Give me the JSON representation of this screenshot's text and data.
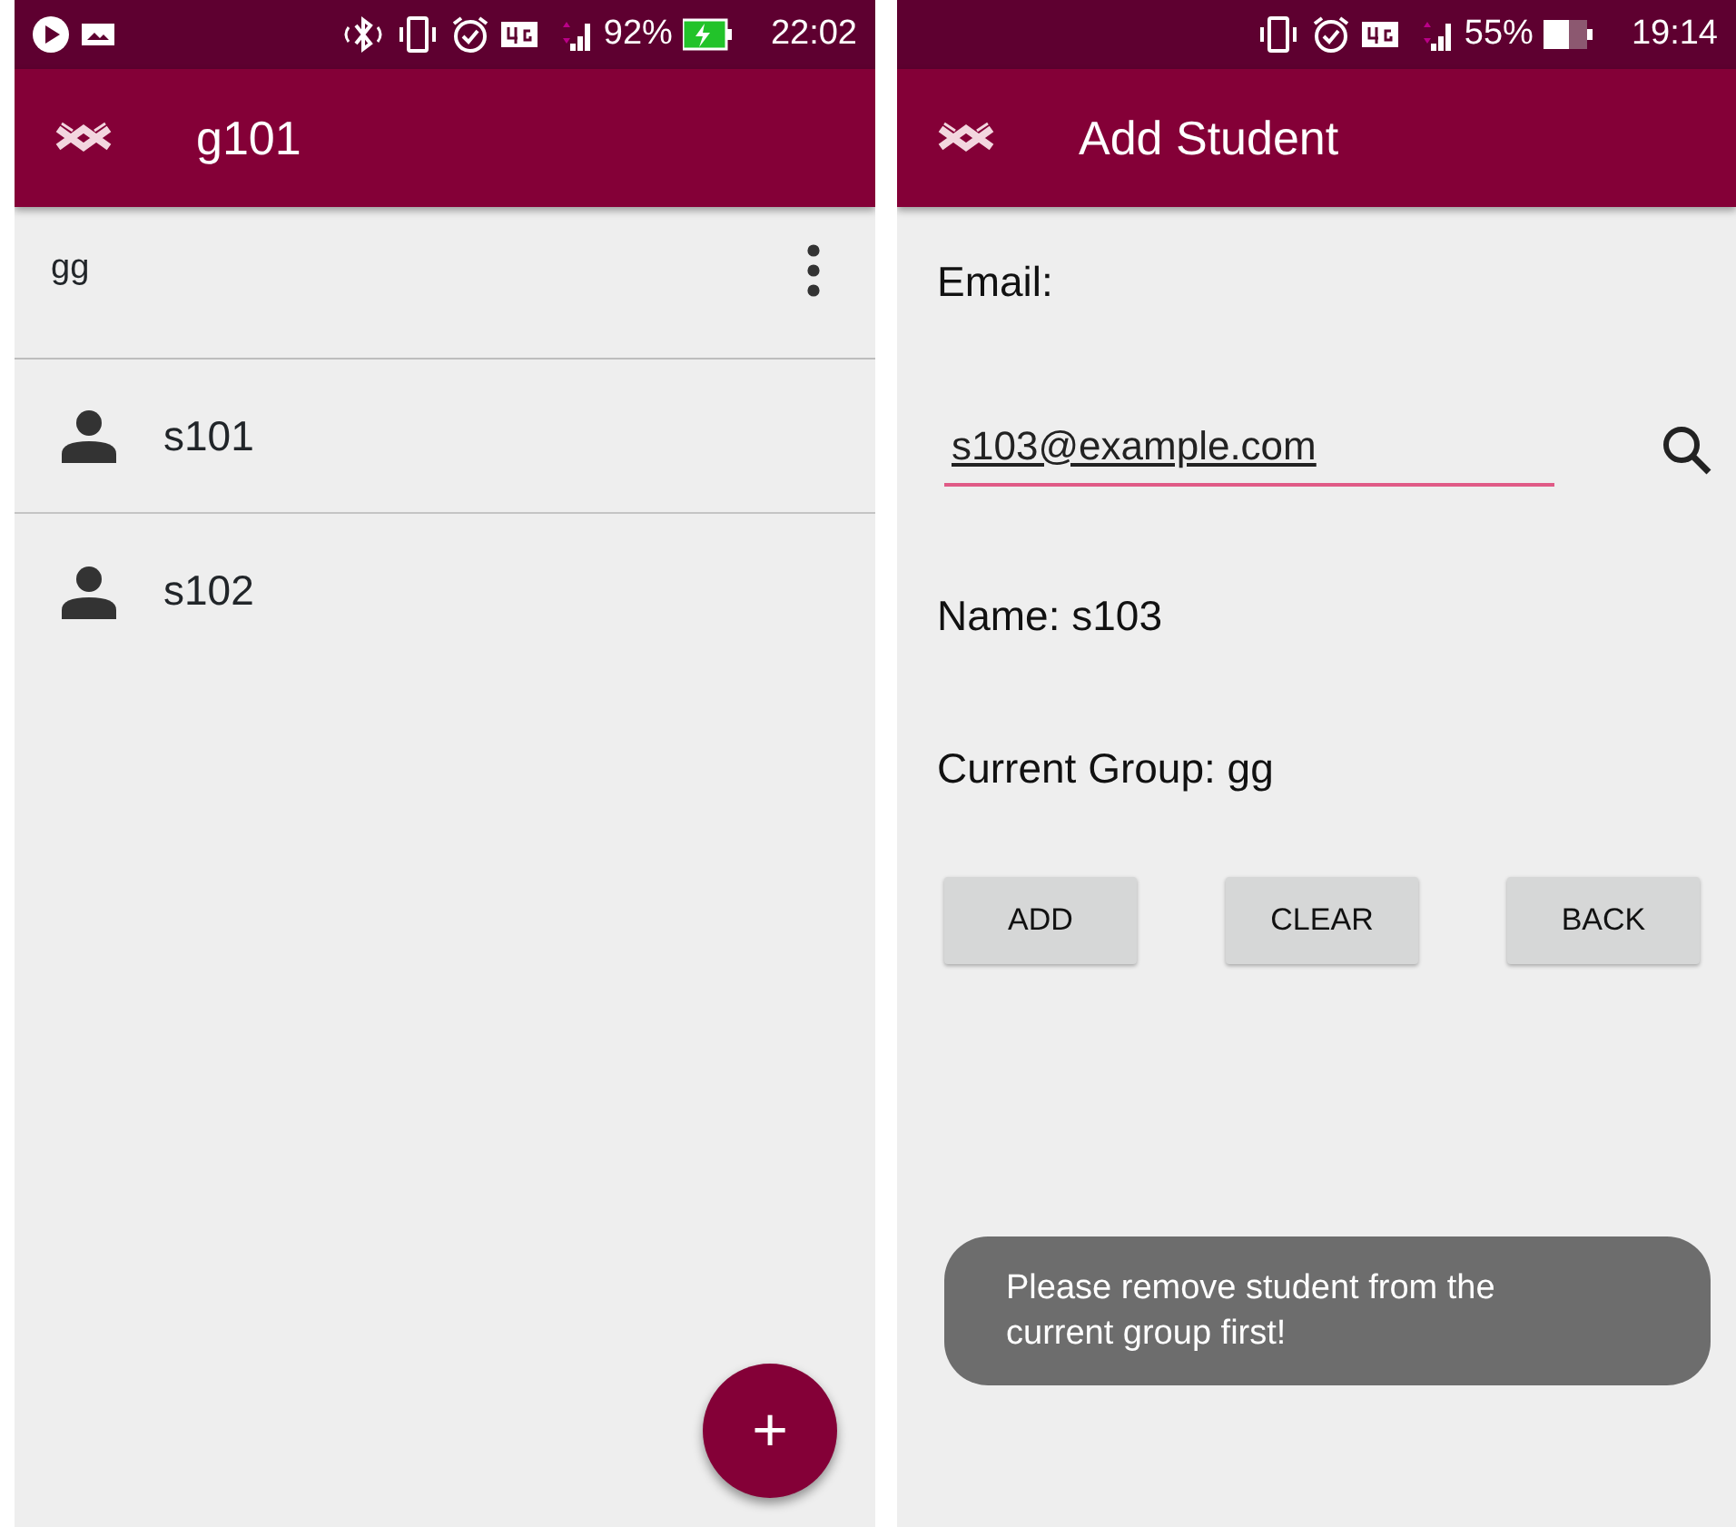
{
  "left_screen": {
    "status_bar": {
      "battery": "92%",
      "time": "22:02",
      "charging": true,
      "bluetooth": true,
      "media_notifications": true
    },
    "app_bar": {
      "title": "g101"
    },
    "group_header": {
      "text": "gg"
    },
    "students": [
      {
        "name": "s101"
      },
      {
        "name": "s102"
      }
    ],
    "fab": {
      "label": "+"
    }
  },
  "right_screen": {
    "status_bar": {
      "battery": "55%",
      "time": "19:14",
      "charging": false,
      "bluetooth": false,
      "media_notifications": false
    },
    "app_bar": {
      "title": "Add Student"
    },
    "email_label": "Email:",
    "email_field": {
      "value": "s103@example.com",
      "focused": true
    },
    "name_text": "Name: s103",
    "group_text": "Current Group: gg",
    "buttons": [
      "ADD",
      "CLEAR",
      "BACK"
    ],
    "toast": "Please remove student from the current group first!"
  }
}
